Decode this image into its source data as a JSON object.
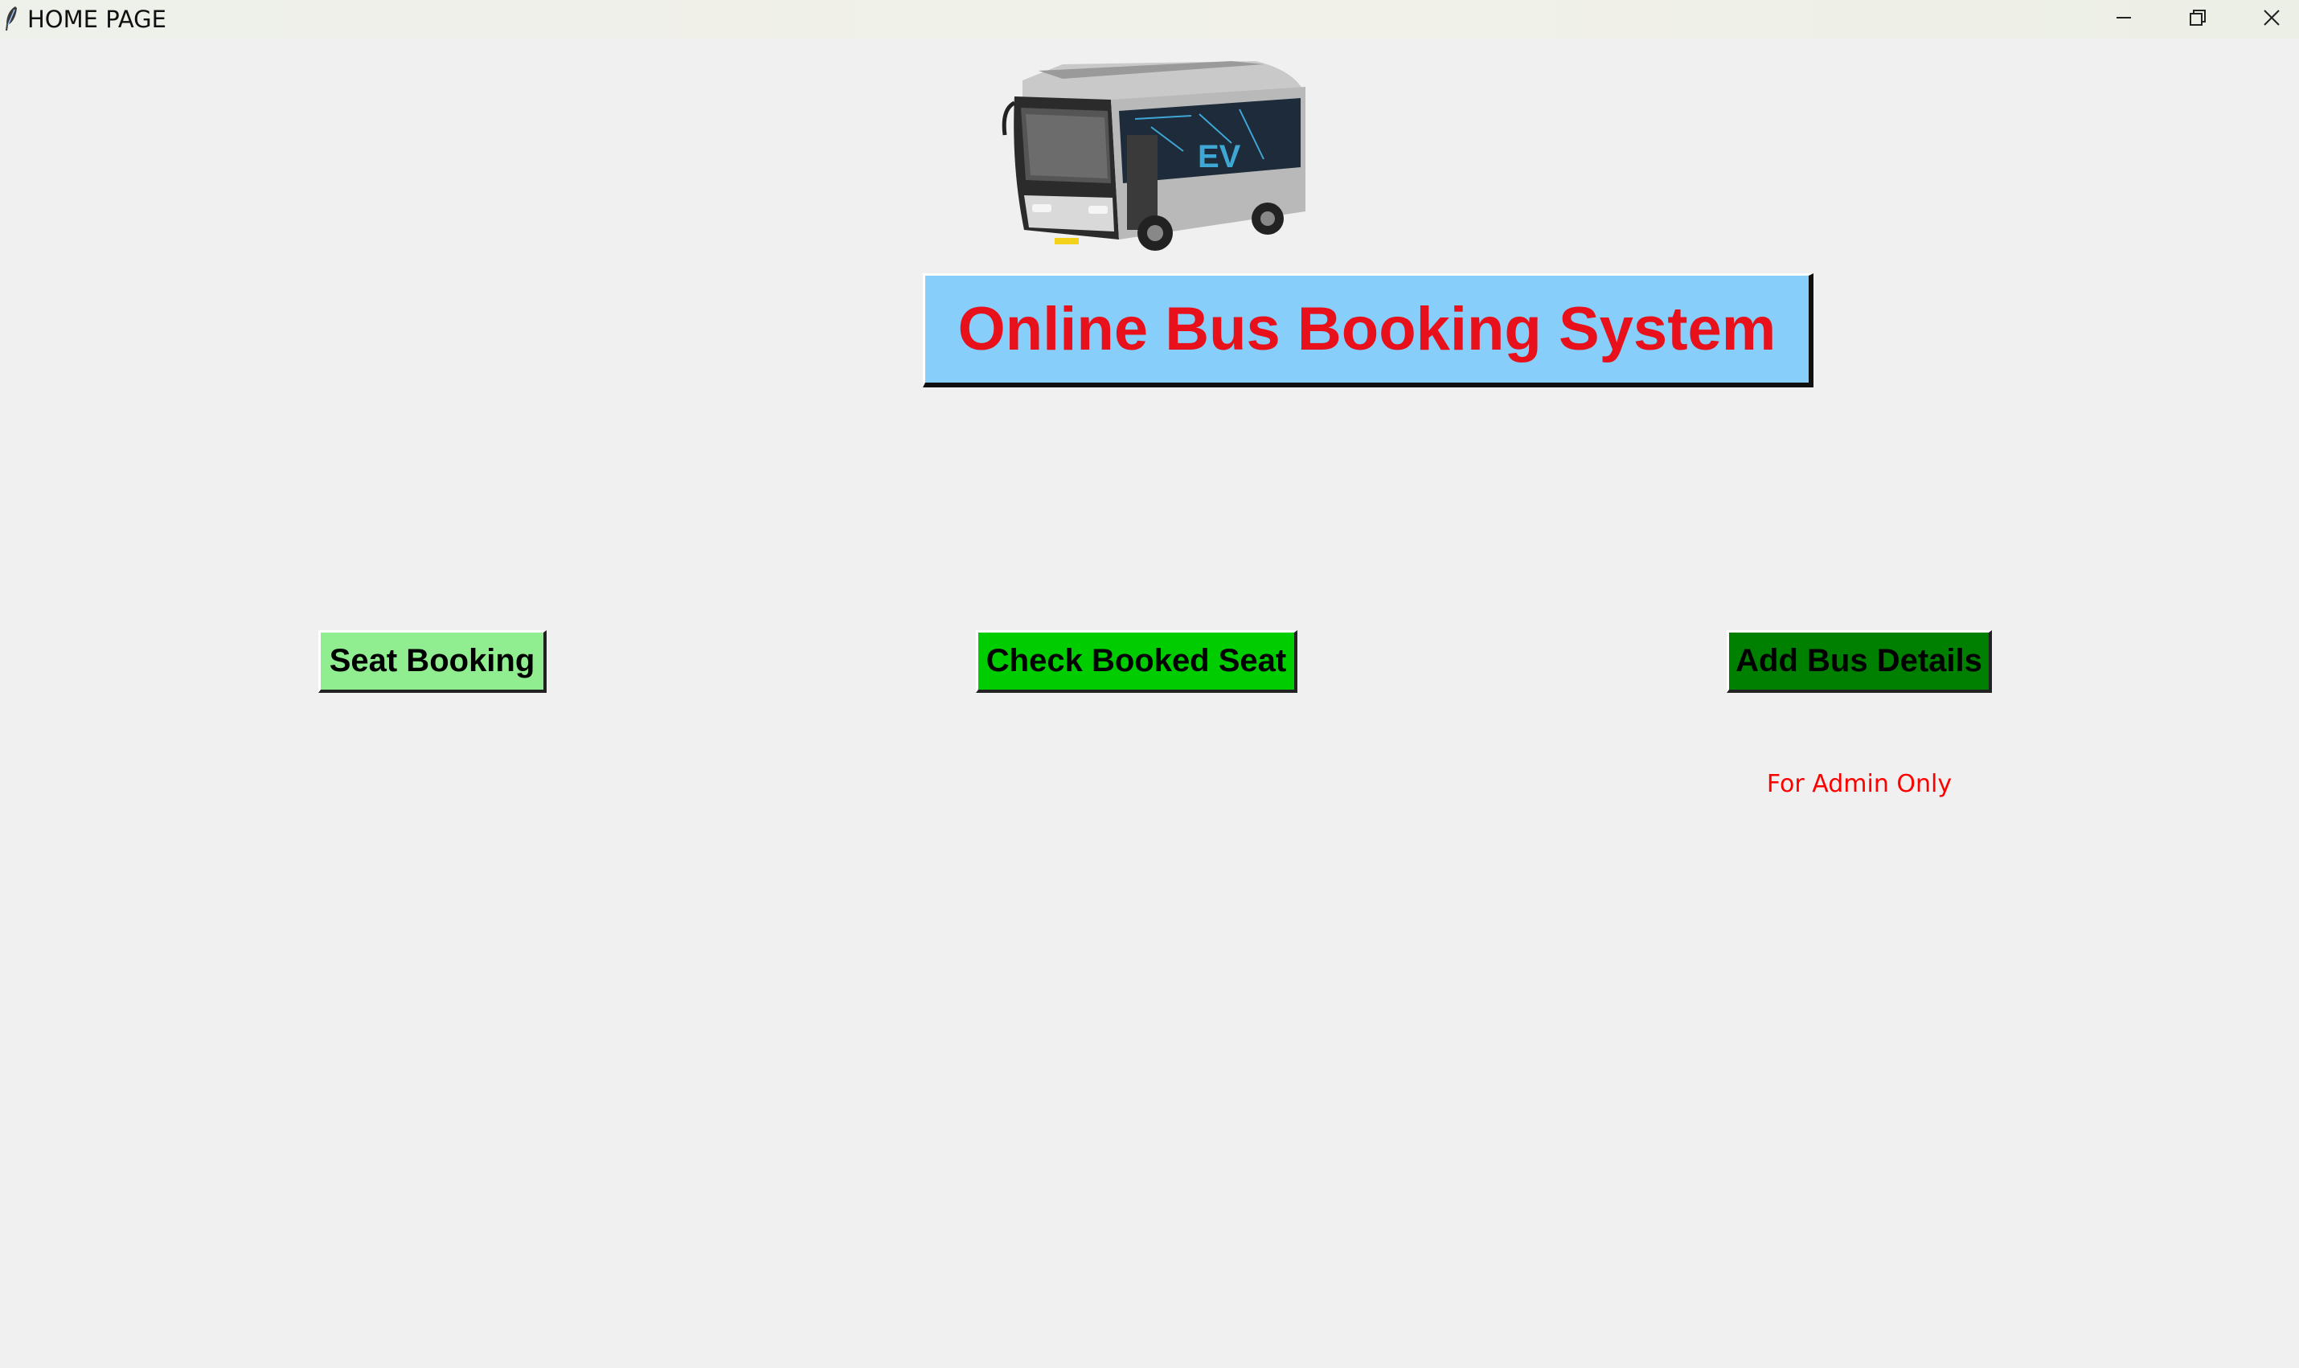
{
  "window": {
    "title": "HOME PAGE",
    "controls": [
      "minimize-icon",
      "restore-icon",
      "close-icon"
    ]
  },
  "header": {
    "image": "bus-image",
    "title": "Online Bus Booking System",
    "title_color": "#e8101a",
    "title_background": "#87cefa"
  },
  "actions": {
    "seat_booking": {
      "label": "Seat Booking",
      "color": "#90ee90"
    },
    "check_booked_seat": {
      "label": "Check Booked Seat",
      "color": "#00cd00"
    },
    "add_bus_details": {
      "label": "Add Bus Details",
      "color": "#008000"
    },
    "admin_note": "For Admin Only",
    "admin_note_color": "#ff0000"
  }
}
